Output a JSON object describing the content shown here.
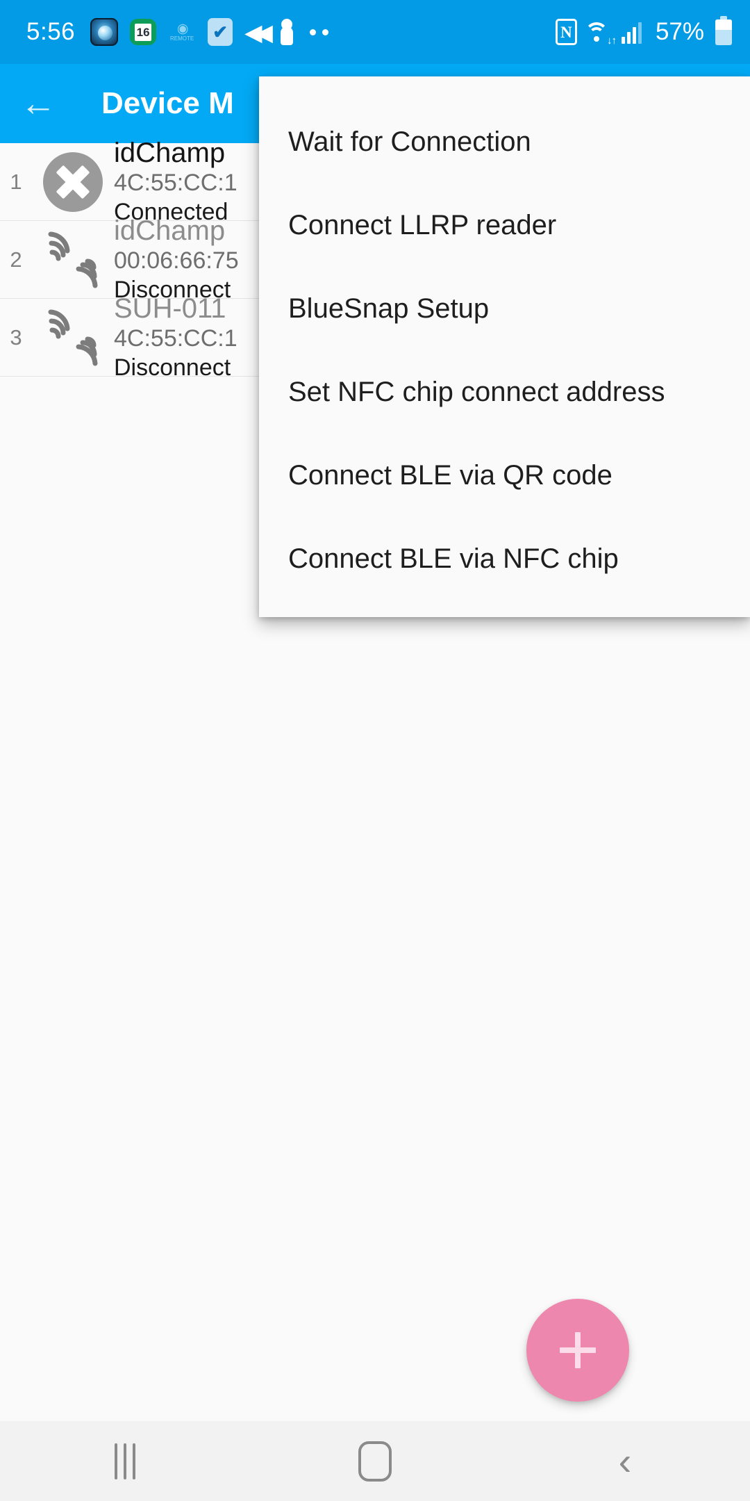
{
  "status_bar": {
    "clock": "5:56",
    "battery_percent": "57%",
    "calendar_day": "16",
    "remote_label": "REMOTE",
    "notification_icons": [
      "viewpro-camera-icon",
      "calendar-icon",
      "toyota-remote-icon",
      "checkbox-app-icon",
      "rewind-icon",
      "person-icon",
      "more-dots-icon"
    ],
    "system_icons": [
      "nfc-icon",
      "wifi-icon",
      "cellular-signal-icon",
      "battery-icon"
    ],
    "nfc_glyph": "N",
    "bar_color": "#039BE5"
  },
  "app_bar": {
    "title": "Device M",
    "back_icon": "←",
    "bar_color": "#03A9F4"
  },
  "device_list": [
    {
      "index": "1",
      "name": "idChamp",
      "mac": "4C:55:CC:1",
      "status": "Connected",
      "icon": "connected-x-icon",
      "connected": true
    },
    {
      "index": "2",
      "name": "idChamp",
      "mac": "00:06:66:75",
      "status": "Disconnect",
      "icon": "rfid-signal-icon",
      "connected": false
    },
    {
      "index": "3",
      "name": "SUH-011",
      "mac": "4C:55:CC:1",
      "status": "Disconnect",
      "icon": "rfid-signal-icon",
      "connected": false
    }
  ],
  "popup_menu": {
    "items": [
      {
        "label": "Wait for Connection"
      },
      {
        "label": "Connect LLRP reader"
      },
      {
        "label": "BlueSnap Setup"
      },
      {
        "label": "Set NFC chip connect address"
      },
      {
        "label": "Connect BLE via QR code"
      },
      {
        "label": "Connect BLE via NFC chip"
      }
    ]
  },
  "fab": {
    "icon": "plus-icon",
    "color": "#EE87AE"
  },
  "nav_bar": {
    "recents_label": "recents-icon",
    "home_label": "home-icon",
    "back_label": "‹"
  }
}
